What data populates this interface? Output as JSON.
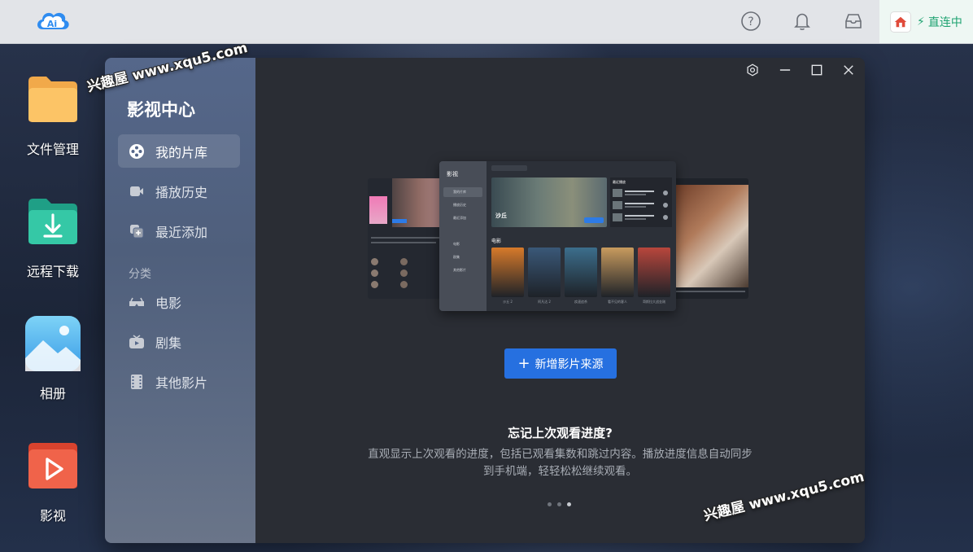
{
  "topbar": {
    "help_icon": "help-circle-icon",
    "bell_icon": "bell-icon",
    "inbox_icon": "inbox-icon",
    "connection_label": "直连中"
  },
  "desktop": {
    "icons": [
      {
        "label": "文件管理",
        "icon": "folder-icon"
      },
      {
        "label": "远程下载",
        "icon": "download-icon"
      },
      {
        "label": "相册",
        "icon": "photo-icon"
      },
      {
        "label": "影视",
        "icon": "play-icon"
      }
    ]
  },
  "app": {
    "title": "影视中心",
    "nav": [
      {
        "label": "我的片库",
        "icon": "film-reel-icon",
        "active": true
      },
      {
        "label": "播放历史",
        "icon": "video-history-icon"
      },
      {
        "label": "最近添加",
        "icon": "recent-add-icon"
      }
    ],
    "category_label": "分类",
    "categories": [
      {
        "label": "电影",
        "icon": "movie-glasses-icon"
      },
      {
        "label": "剧集",
        "icon": "tv-icon"
      },
      {
        "label": "其他影片",
        "icon": "filmstrip-icon"
      }
    ],
    "add_source_button": "新增影片来源",
    "tip_title": "忘记上次观看进度?",
    "tip_desc": "直观显示上次观看的进度，包括已观看集数和跳过内容。播放进度信息自动同步到手机端，轻轻松松继续观看。",
    "carousel": {
      "total": 3,
      "current": 3
    }
  },
  "preview": {
    "app_title": "影视",
    "nav": [
      "我的片库",
      "播放历史",
      "最近添加",
      "电影",
      "剧集",
      "其他影片"
    ],
    "hero_title": "沙丘",
    "recent_title": "最近播放",
    "section": "电影",
    "posters": [
      {
        "caption": "沙丘 2",
        "color": "#d77a2a"
      },
      {
        "caption": "阿凡达 2",
        "color": "#3a5878"
      },
      {
        "caption": "疾速追杀",
        "color": "#3c6e8c"
      },
      {
        "caption": "看不见的客人",
        "color": "#c89b5e"
      },
      {
        "caption": "哥斯拉大战金刚",
        "color": "#b8463c"
      }
    ]
  },
  "watermark": "兴趣屋 www.xqu5.com"
}
